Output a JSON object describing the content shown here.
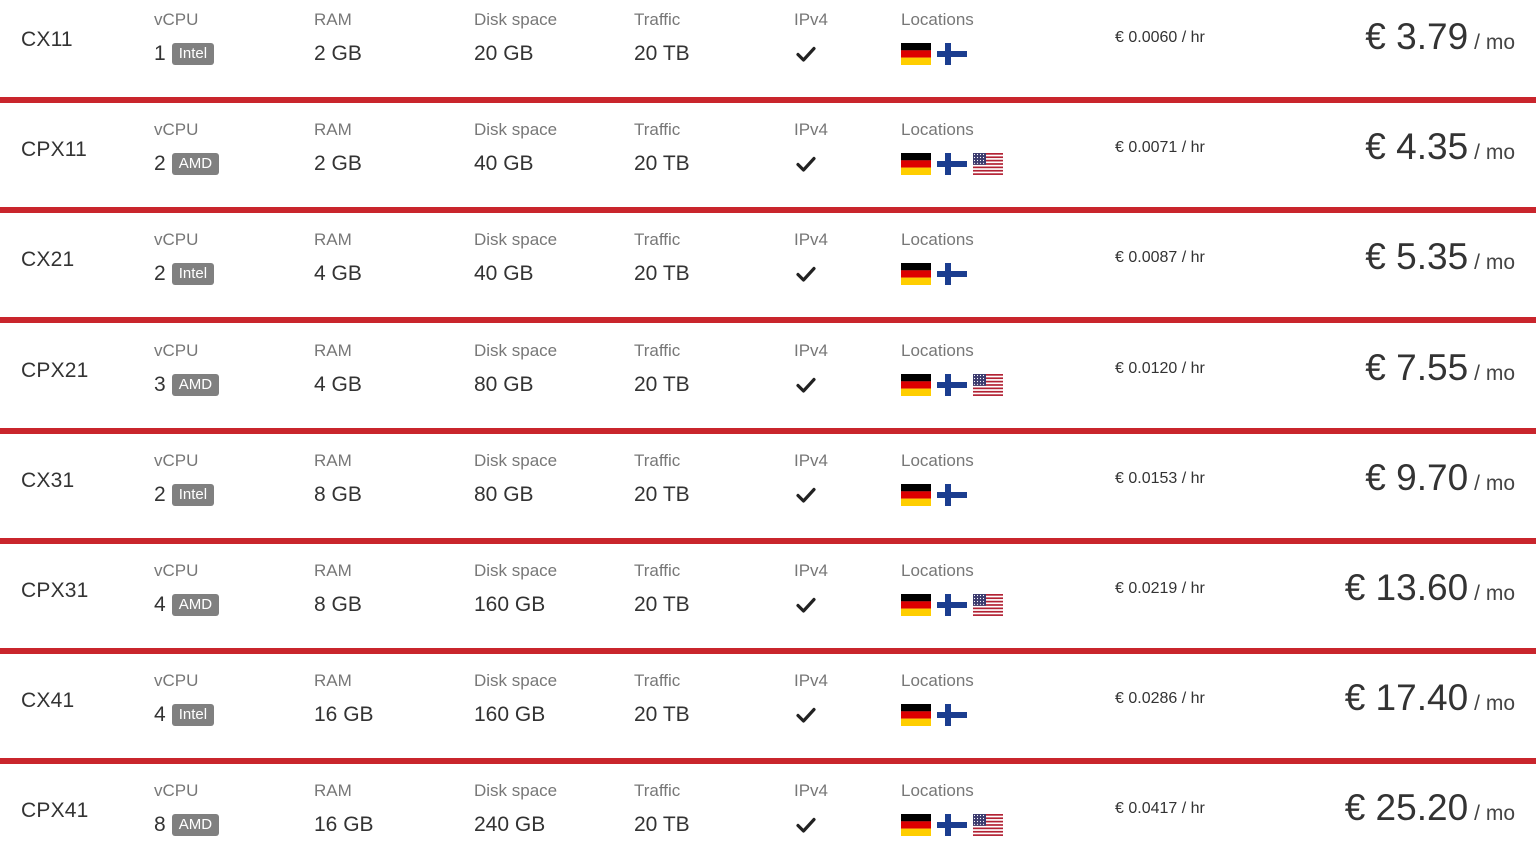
{
  "labels": {
    "vcpu": "vCPU",
    "ram": "RAM",
    "disk": "Disk space",
    "traffic": "Traffic",
    "ipv4": "IPv4",
    "locations": "Locations",
    "per_month": "/ mo"
  },
  "colors": {
    "accent": "#c9252c",
    "badge": "#808080"
  },
  "plans": [
    {
      "name": "CX11",
      "vcpu": "1",
      "cpu_type": "Intel",
      "ram": "2 GB",
      "disk": "20 GB",
      "traffic": "20 TB",
      "ipv4": "check-icon",
      "locations": [
        "de",
        "fi"
      ],
      "hourly": "€ 0.0060 / hr",
      "monthly": "€ 3.79"
    },
    {
      "name": "CPX11",
      "vcpu": "2",
      "cpu_type": "AMD",
      "ram": "2 GB",
      "disk": "40 GB",
      "traffic": "20 TB",
      "ipv4": "check-icon",
      "locations": [
        "de",
        "fi",
        "us"
      ],
      "hourly": "€ 0.0071 / hr",
      "monthly": "€ 4.35"
    },
    {
      "name": "CX21",
      "vcpu": "2",
      "cpu_type": "Intel",
      "ram": "4 GB",
      "disk": "40 GB",
      "traffic": "20 TB",
      "ipv4": "check-icon",
      "locations": [
        "de",
        "fi"
      ],
      "hourly": "€ 0.0087 / hr",
      "monthly": "€ 5.35"
    },
    {
      "name": "CPX21",
      "vcpu": "3",
      "cpu_type": "AMD",
      "ram": "4 GB",
      "disk": "80 GB",
      "traffic": "20 TB",
      "ipv4": "check-icon",
      "locations": [
        "de",
        "fi",
        "us"
      ],
      "hourly": "€ 0.0120 / hr",
      "monthly": "€ 7.55"
    },
    {
      "name": "CX31",
      "vcpu": "2",
      "cpu_type": "Intel",
      "ram": "8 GB",
      "disk": "80 GB",
      "traffic": "20 TB",
      "ipv4": "check-icon",
      "locations": [
        "de",
        "fi"
      ],
      "hourly": "€ 0.0153 / hr",
      "monthly": "€ 9.70"
    },
    {
      "name": "CPX31",
      "vcpu": "4",
      "cpu_type": "AMD",
      "ram": "8 GB",
      "disk": "160 GB",
      "traffic": "20 TB",
      "ipv4": "check-icon",
      "locations": [
        "de",
        "fi",
        "us"
      ],
      "hourly": "€ 0.0219 / hr",
      "monthly": "€ 13.60"
    },
    {
      "name": "CX41",
      "vcpu": "4",
      "cpu_type": "Intel",
      "ram": "16 GB",
      "disk": "160 GB",
      "traffic": "20 TB",
      "ipv4": "check-icon",
      "locations": [
        "de",
        "fi"
      ],
      "hourly": "€ 0.0286 / hr",
      "monthly": "€ 17.40"
    },
    {
      "name": "CPX41",
      "vcpu": "8",
      "cpu_type": "AMD",
      "ram": "16 GB",
      "disk": "240 GB",
      "traffic": "20 TB",
      "ipv4": "check-icon",
      "locations": [
        "de",
        "fi",
        "us"
      ],
      "hourly": "€ 0.0417 / hr",
      "monthly": "€ 25.20"
    }
  ]
}
